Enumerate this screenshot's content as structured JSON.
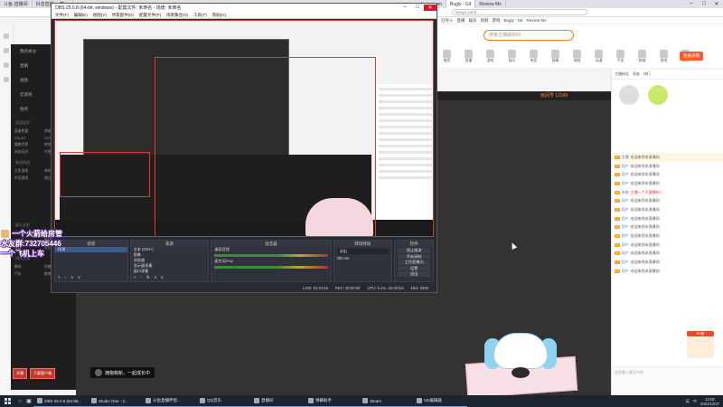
{
  "browser": {
    "tabs": [
      "斗鱼-直播间",
      "抖音直播-一款...",
      "douyu.com",
      "Bugly - Git",
      "Review Ms"
    ],
    "address": "douyu.com/...",
    "bookmarks": [
      "已导入",
      "直播",
      "娱乐",
      "视频",
      "游戏",
      "Bugly",
      "Git",
      "Review Ms"
    ],
    "search_placeholder": "搜索主播或房间"
  },
  "site_nav": {
    "items": [
      "推荐",
      "直播",
      "游戏",
      "娱乐",
      "电竞",
      "赛事",
      "视频",
      "动漫",
      "手游",
      "商城",
      "鱼吧",
      "消息",
      "历史",
      "关注"
    ],
    "open_live_button": "我要开播"
  },
  "left_menu": {
    "items": [
      "我的关注",
      "直播",
      "视频",
      "云游戏",
      "鱼吧"
    ],
    "sections": [
      {
        "title": "网游竞技",
        "items": [
          "英雄联盟",
          "穿越火线",
          "CS:GO",
          "DOTA2",
          "魔兽世界",
          "绝地求生",
          "永劫无间",
          "守望先锋"
        ]
      },
      {
        "title": "单机热游",
        "items": [
          "主机游戏",
          "单机游戏",
          "怀旧游戏",
          "独立游戏"
        ]
      },
      {
        "title": "娱乐天地",
        "items": [
          "颜值",
          "户外",
          "二次元",
          "舞蹈",
          "美食",
          "音乐"
        ]
      },
      {
        "title": "科技文化",
        "items": [
          "数码",
          "科普",
          "汽车",
          "教育"
        ]
      }
    ],
    "footer_buttons": [
      "开播",
      "下载客户端"
    ]
  },
  "room": {
    "title_line": "房间号 12345",
    "anchor_hint": "拥抱萌新，一起成长中"
  },
  "chat": {
    "tabs": [
      "主播粉丝",
      "贵族",
      "排行"
    ],
    "messages": [
      {
        "level": "LV",
        "name": "主播",
        "text": "欢迎来到本直播间",
        "red": false,
        "hl": true
      },
      {
        "level": "LV",
        "name": "用户",
        "text": "欢迎来到本直播间",
        "red": false,
        "hl": false
      },
      {
        "level": "LV",
        "name": "用户",
        "text": "欢迎来到本直播间",
        "red": false,
        "hl": false
      },
      {
        "level": "LV",
        "name": "用户",
        "text": "欢迎来到本直播间",
        "red": false,
        "hl": false
      },
      {
        "level": "LV",
        "name": "系统",
        "text": "主播一个不要播吗？",
        "red": true,
        "hl": false
      },
      {
        "level": "LV",
        "name": "用户",
        "text": "欢迎来到本直播间",
        "red": false,
        "hl": false
      },
      {
        "level": "LV",
        "name": "用户",
        "text": "欢迎来到本直播间",
        "red": false,
        "hl": false
      },
      {
        "level": "LV",
        "name": "用户",
        "text": "欢迎来到本直播间",
        "red": false,
        "hl": false
      },
      {
        "level": "LV",
        "name": "用户",
        "text": "欢迎来到本直播间",
        "red": false,
        "hl": false
      },
      {
        "level": "LV",
        "name": "用户",
        "text": "欢迎来到本直播间",
        "red": false,
        "hl": false
      },
      {
        "level": "LV",
        "name": "用户",
        "text": "欢迎来到本直播间",
        "red": false,
        "hl": false
      },
      {
        "level": "LV",
        "name": "用户",
        "text": "欢迎来到本直播间",
        "red": false,
        "hl": false
      },
      {
        "level": "LV",
        "name": "用户",
        "text": "欢迎来到本直播间",
        "red": false,
        "hl": false
      },
      {
        "level": "LV",
        "name": "用户",
        "text": "欢迎来到本直播间",
        "red": false,
        "hl": false
      }
    ],
    "input_placeholder": "这里输入聊天内容"
  },
  "obs": {
    "title": "OBS 25.0.8 (64-bit, windows) - 配置文件: 未命名 - 场景: 未命名",
    "menu": [
      "文件(F)",
      "编辑(E)",
      "视图(V)",
      "停靠部件(D)",
      "配置文件(P)",
      "场景集合(S)",
      "工具(T)",
      "帮助(H)"
    ],
    "docks": {
      "scenes": {
        "title": "场景",
        "items": [
          "场景"
        ]
      },
      "sources": {
        "title": "来源",
        "items": [
          "文本 (GDI+)",
          "图像",
          "浏览器",
          "显示器采集",
          "窗口采集",
          "音频输入采集",
          "图像"
        ]
      },
      "mixer": {
        "title": "混音器",
        "channels": [
          "桌面音频",
          "麦克风/Aux"
        ]
      },
      "transitions": {
        "title": "转场特效",
        "value": "淡出",
        "duration": "300 ms"
      },
      "controls": {
        "title": "控件",
        "buttons": [
          "停止推流",
          "开始录制",
          "工作室模式",
          "设置",
          "退出"
        ]
      }
    },
    "status": [
      "LIVE: 01:23:45",
      "REC: 00:00:00",
      "CPU: 6.1%, 30.00 fps",
      "kb/s: 2500"
    ]
  },
  "overlay": {
    "lines": [
      "一个火箭给房管",
      "水友群:732705446",
      "一个飞机上车"
    ]
  },
  "taskbar": {
    "apps": [
      "OBS 25.0.8 (64-bit...",
      "Studio One - 3...",
      "斗鱼直播伴侣...",
      "QQ音乐",
      "直播间",
      "弹幕助手",
      "Steam",
      "UE编辑器"
    ],
    "tray": [
      "英",
      "中"
    ],
    "time": "12:08",
    "date": "2021/12/27"
  },
  "mascot_right_badge": "PK赛"
}
